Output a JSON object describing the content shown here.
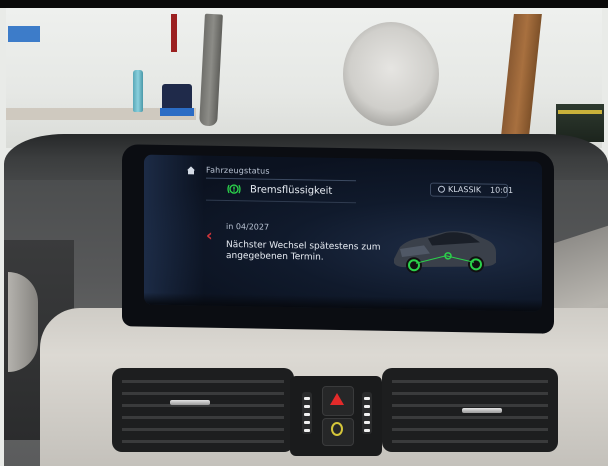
{
  "screen": {
    "title": "Fahrzeugstatus",
    "mode_label": "KLASSIK",
    "clock": "10:01",
    "item_label": "Bremsflüssigkeit",
    "date": "in 04/2027",
    "message": "Nächster Wechsel spätestens zum angegebenen Termin."
  },
  "icons": {
    "home": "home-icon",
    "compass": "compass-icon",
    "brake_fluid": "brake-fluid-icon",
    "back": "chevron-left-icon",
    "hazard": "hazard-warning-icon",
    "lock": "central-lock-icon"
  },
  "colors": {
    "status_green": "#2bd14a",
    "accent_red": "#d0343a",
    "screen_bg": "#0b1220",
    "hazard_red": "#e32a2a"
  }
}
